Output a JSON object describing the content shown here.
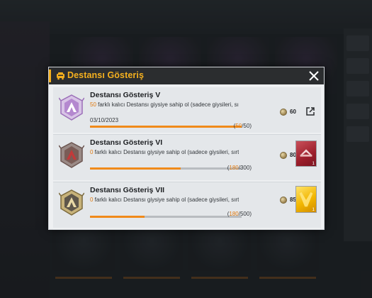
{
  "modal": {
    "title": "Destansı Gösteriş",
    "header_icon": "trophy-car-icon",
    "close_icon": "close-x-icon"
  },
  "achievements": [
    {
      "name": "Destansı Gösteriş V",
      "desc_count": "50",
      "desc_text": " farklı kalıcı Destansı giysiye sahip ol (sadece giysileri, sırt",
      "date": "03/10/2023",
      "current": "50",
      "target": "50",
      "progress": 1.0,
      "points": "60",
      "emblem": "purple-emblem",
      "action": "share-icon"
    },
    {
      "name": "Destansı Gösteriş VI",
      "desc_count": "0",
      "desc_text": " farklı kalıcı Destansı giysiye sahip ol (sadece giysileri, sırt ç",
      "current": "180",
      "target": "300",
      "progress": 0.6,
      "points": "80",
      "emblem": "bronze-emblem",
      "reward_count": "1",
      "reward_color": "#b8323f"
    },
    {
      "name": "Destansı Gösteriş VII",
      "desc_count": "0",
      "desc_text": " farklı kalıcı Destansı giysiye sahip ol (sadece giysileri, sırt ç",
      "current": "180",
      "target": "500",
      "progress": 0.36,
      "points": "85",
      "emblem": "gold-emblem",
      "reward_count": "1",
      "reward_color": "#f2b600"
    }
  ],
  "colors": {
    "accent": "#f5b01e",
    "progress": "#f08a1a",
    "header_bg": "#2b2d2f",
    "modal_bg": "#eef0f2"
  }
}
